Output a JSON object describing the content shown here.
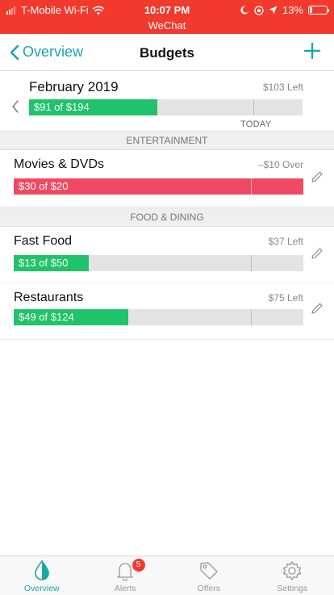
{
  "status_bar": {
    "carrier": "T-Mobile Wi-Fi",
    "time": "10:07 PM",
    "subtitle": "WeChat",
    "battery": "13%",
    "battery_level": 0.13,
    "color": "#f2392d"
  },
  "nav": {
    "back_label": "Overview",
    "title": "Budgets",
    "add_icon": "plus-icon",
    "accent": "#1ba6a6"
  },
  "month": {
    "title": "February 2019",
    "remaining": "$103 Left",
    "progress_label": "$91 of $194",
    "spent": 91,
    "total": 194,
    "today_fraction": 0.82,
    "today_label": "TODAY"
  },
  "sections": [
    {
      "header": "ENTERTAINMENT",
      "budgets": [
        {
          "name": "Movies & DVDs",
          "status": "–$10 Over",
          "progress_label": "$30 of $20",
          "spent": 30,
          "total": 20,
          "state": "over"
        }
      ]
    },
    {
      "header": "FOOD & DINING",
      "budgets": [
        {
          "name": "Fast Food",
          "status": "$37 Left",
          "progress_label": "$13 of $50",
          "spent": 13,
          "total": 50,
          "state": "under"
        },
        {
          "name": "Restaurants",
          "status": "$75 Left",
          "progress_label": "$49 of $124",
          "spent": 49,
          "total": 124,
          "state": "under"
        }
      ]
    }
  ],
  "colors": {
    "under": "#1fc46a",
    "over": "#ef4a62",
    "track": "#e3e3e3"
  },
  "tabs": [
    {
      "label": "Overview",
      "icon": "overview-drop-icon",
      "active": true
    },
    {
      "label": "Alerts",
      "icon": "bell-icon",
      "badge": "5"
    },
    {
      "label": "Offers",
      "icon": "tag-icon"
    },
    {
      "label": "Settings",
      "icon": "gear-icon"
    }
  ]
}
